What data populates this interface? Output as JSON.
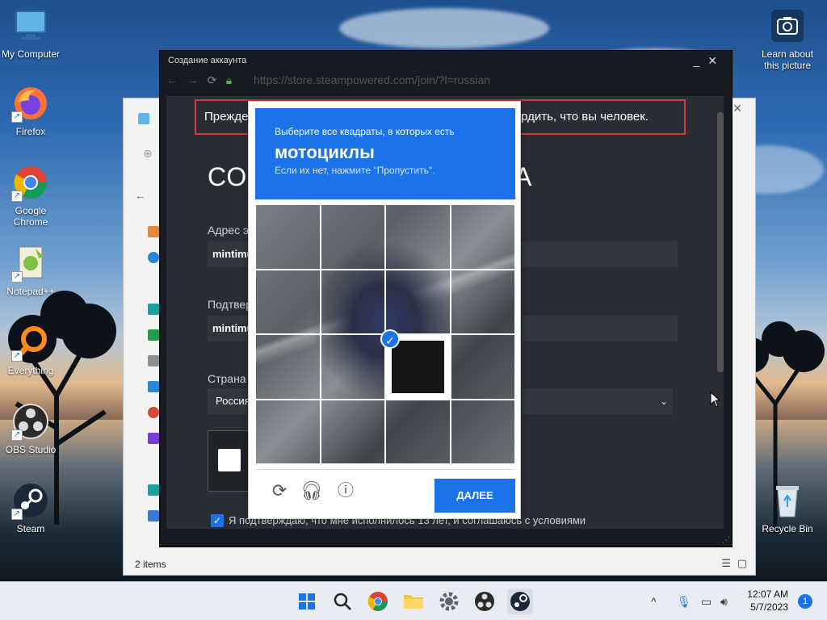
{
  "desktop": {
    "icons": [
      {
        "label": "My Computer"
      },
      {
        "label": "Firefox"
      },
      {
        "label": "Google Chrome"
      },
      {
        "label": "Notepad++"
      },
      {
        "label": "Everything"
      },
      {
        "label": "OBS Studio"
      },
      {
        "label": "Steam"
      }
    ],
    "learn_about": "Learn about this picture",
    "recycle_bin": "Recycle Bin"
  },
  "explorer": {
    "status_items": "2 items"
  },
  "steam_window": {
    "title": "Создание аккаунта",
    "url": "https://store.steampowered.com/join/?l=russian",
    "banner_left": "Прежде",
    "banner_right": "рдить, что вы человек.",
    "page_title_left": "СО",
    "page_title_right": "А",
    "email_label": "Адрес э",
    "email_value": "mintimu",
    "confirm_label": "Подтвер",
    "confirm_value": "mintimu",
    "country_label": "Страна",
    "country_value": "Россия",
    "agree_text": "Я подтверждаю, что мне исполнилось 13 лет, и соглашаюсь с условиями"
  },
  "captcha": {
    "instruction": "Выберите все квадраты, в которых есть",
    "object": "мотоциклы",
    "hint": "Если их нет, нажмите \"Пропустить\".",
    "next_button": "ДАЛЕЕ",
    "selected_cell": {
      "row": 2,
      "col": 2
    }
  },
  "taskbar": {
    "time": "12:07 AM",
    "date": "5/7/2023",
    "notification_count": "1"
  },
  "colors": {
    "captcha_blue": "#1a73e8",
    "steam_bg": "#171a21",
    "url_green": "#4caf50",
    "banner_red": "#c94040"
  }
}
